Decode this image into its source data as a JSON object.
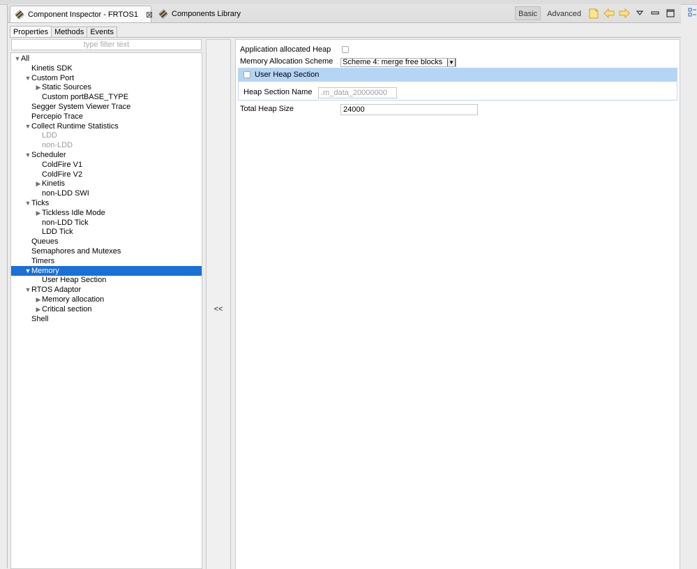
{
  "tabs": {
    "inspector_label": "Component Inspector - FRTOS1",
    "library_label": "Components Library"
  },
  "toolbar": {
    "basic_label": "Basic",
    "advanced_label": "Advanced"
  },
  "subtabs": [
    "Properties",
    "Methods",
    "Events"
  ],
  "filter": {
    "placeholder": "type filter text"
  },
  "tree": [
    {
      "label": "All",
      "level": 0,
      "twisty": "open"
    },
    {
      "label": "Kinetis SDK",
      "level": 1,
      "twisty": "none"
    },
    {
      "label": "Custom Port",
      "level": 1,
      "twisty": "open"
    },
    {
      "label": "Static Sources",
      "level": 2,
      "twisty": "closed"
    },
    {
      "label": "Custom portBASE_TYPE",
      "level": 2,
      "twisty": "none"
    },
    {
      "label": "Segger System Viewer Trace",
      "level": 1,
      "twisty": "none"
    },
    {
      "label": "Percepio Trace",
      "level": 1,
      "twisty": "none"
    },
    {
      "label": "Collect Runtime Statistics",
      "level": 1,
      "twisty": "open"
    },
    {
      "label": "LDD",
      "level": 2,
      "twisty": "none",
      "disabled": true
    },
    {
      "label": "non-LDD",
      "level": 2,
      "twisty": "none",
      "disabled": true
    },
    {
      "label": "Scheduler",
      "level": 1,
      "twisty": "open"
    },
    {
      "label": "ColdFire V1",
      "level": 2,
      "twisty": "none"
    },
    {
      "label": "ColdFire V2",
      "level": 2,
      "twisty": "none"
    },
    {
      "label": "Kinetis",
      "level": 2,
      "twisty": "closed"
    },
    {
      "label": "non-LDD SWI",
      "level": 2,
      "twisty": "none"
    },
    {
      "label": "Ticks",
      "level": 1,
      "twisty": "open"
    },
    {
      "label": "Tickless Idle Mode",
      "level": 2,
      "twisty": "closed"
    },
    {
      "label": "non-LDD Tick",
      "level": 2,
      "twisty": "none"
    },
    {
      "label": "LDD Tick",
      "level": 2,
      "twisty": "none"
    },
    {
      "label": "Queues",
      "level": 1,
      "twisty": "none"
    },
    {
      "label": "Semaphores and Mutexes",
      "level": 1,
      "twisty": "none"
    },
    {
      "label": "Timers",
      "level": 1,
      "twisty": "none"
    },
    {
      "label": "Memory",
      "level": 1,
      "twisty": "open",
      "selected": true
    },
    {
      "label": "User Heap Section",
      "level": 2,
      "twisty": "none"
    },
    {
      "label": "RTOS Adaptor",
      "level": 1,
      "twisty": "open"
    },
    {
      "label": "Memory allocation",
      "level": 2,
      "twisty": "closed"
    },
    {
      "label": "Critical section",
      "level": 2,
      "twisty": "closed"
    },
    {
      "label": "Shell",
      "level": 1,
      "twisty": "none"
    }
  ],
  "collapse_label": "<<",
  "props": {
    "app_heap_label": "Application allocated Heap",
    "app_heap_checked": false,
    "alloc_scheme_label": "Memory Allocation Scheme",
    "alloc_scheme_value": "Scheme 4: merge free blocks",
    "user_heap_label": "User Heap Section",
    "user_heap_checked": false,
    "heap_section_name_label": "Heap Section Name",
    "heap_section_name_value": ".m_data_20000000",
    "total_heap_label": "Total Heap Size",
    "total_heap_value": "24000"
  }
}
